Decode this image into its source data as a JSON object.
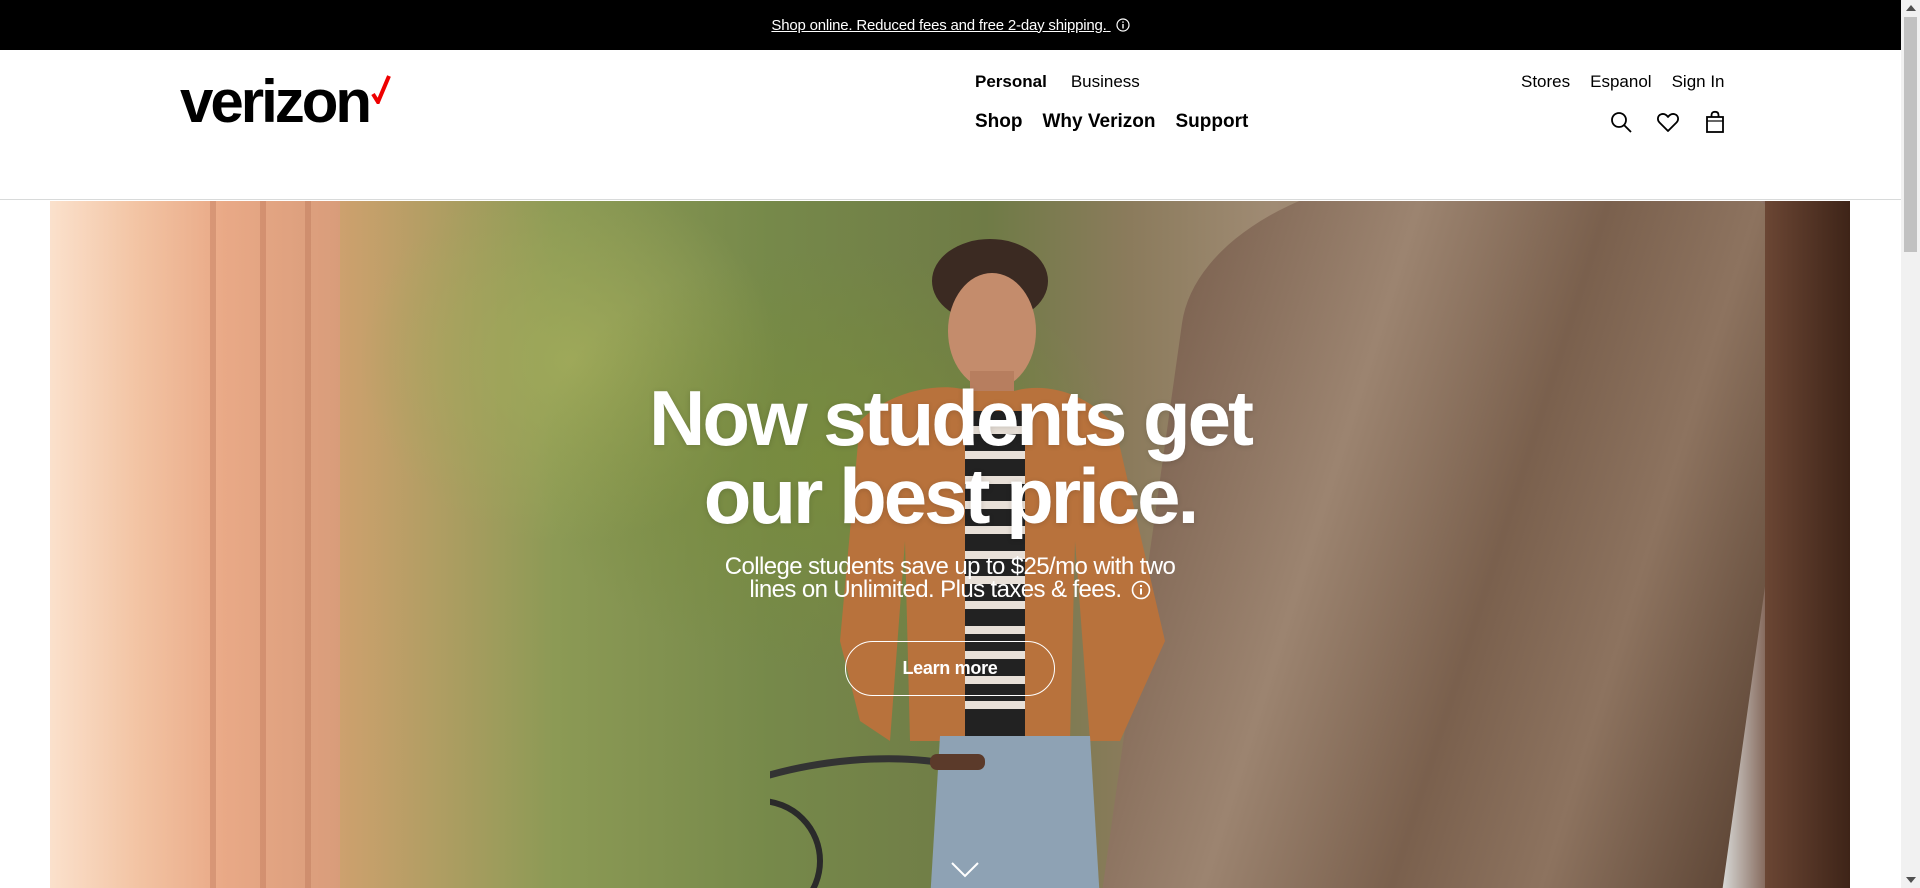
{
  "topbar": {
    "promo_text": "Shop online. Reduced fees and free 2-day shipping.",
    "info_icon": "info-circle-icon"
  },
  "header": {
    "logo_text": "verizon",
    "logo_mark_color": "#ee0000",
    "nav_top": [
      {
        "label": "Personal",
        "active": true
      },
      {
        "label": "Business",
        "active": false
      }
    ],
    "nav_main": [
      "Shop",
      "Why Verizon",
      "Support"
    ],
    "util_links": [
      "Stores",
      "Espanol",
      "Sign In"
    ],
    "util_icons": [
      "search-icon",
      "heart-icon",
      "shopping-bag-icon"
    ]
  },
  "hero": {
    "headline_line1": "Now students get",
    "headline_line2": "our best price.",
    "subtext_line1": "College students save up to $25/mo with two",
    "subtext_line2": "lines on Unlimited. Plus taxes & fees.",
    "cta_label": "Learn more",
    "scroll_icon": "chevron-down-icon"
  },
  "colors": {
    "brand_red": "#ee0000",
    "topbar_bg": "#000000",
    "text": "#000000"
  }
}
